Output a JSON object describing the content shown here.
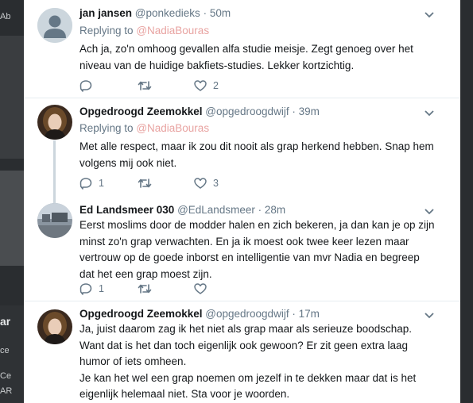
{
  "background": {
    "left_fragments": [
      "Ab",
      "ar",
      "ce",
      "Ce",
      "AR"
    ]
  },
  "tweets": [
    {
      "name": "jan jansen",
      "handle": "@ponkedieks",
      "separator": "·",
      "time": "50m",
      "replying_label": "Replying to",
      "replying_to": "@NadiaBouras",
      "text": "Ach ja, zo'n omhoog gevallen alfa studie meisje. Zegt genoeg over het niveau van de huidige bakfiets-studies. Lekker kortzichtig.",
      "reply_count": "",
      "retweet_count": "",
      "like_count": "2"
    },
    {
      "name": "Opgedroogd Zeemokkel",
      "handle": "@opgedroogdwijf",
      "separator": "·",
      "time": "39m",
      "replying_label": "Replying to",
      "replying_to": "@NadiaBouras",
      "text": "Met alle respect, maar ik zou dit nooit als grap herkend hebben. Snap hem volgens mij ook niet.",
      "reply_count": "1",
      "retweet_count": "",
      "like_count": "3"
    },
    {
      "name": "Ed Landsmeer 030",
      "handle": "@EdLandsmeer",
      "separator": "·",
      "time": "28m",
      "text": "Eerst moslims door de modder halen en zich bekeren, ja dan kan je op zijn minst zo'n grap verwachten. En ja ik moest ook twee keer lezen maar vertrouw op de goede inborst en intelligentie van mvr Nadia en begreep dat het een grap moest zijn.",
      "reply_count": "1",
      "retweet_count": "",
      "like_count": ""
    },
    {
      "name": "Opgedroogd Zeemokkel",
      "handle": "@opgedroogdwijf",
      "separator": "·",
      "time": "17m",
      "text_lines": [
        "Ja, juist daarom zag ik het niet als grap maar als serieuze boodschap. Want dat is het dan toch eigenlijk ook gewoon? Er zit geen extra laag humor of iets omheen.",
        "Je kan het wel een grap noemen om jezelf in te dekken maar dat is het eigenlijk helemaal niet. Sta voor je woorden."
      ]
    }
  ],
  "colors": {
    "text": "#14171a",
    "secondary": "#657786",
    "mention": "#e8a3a1",
    "divider": "#e6ecf0",
    "thread_line": "#ccd6dd",
    "backdrop": "#2a2d30"
  },
  "icons": {
    "reply": "reply-icon",
    "retweet": "retweet-icon",
    "like": "heart-icon",
    "more": "chevron-down-icon"
  }
}
